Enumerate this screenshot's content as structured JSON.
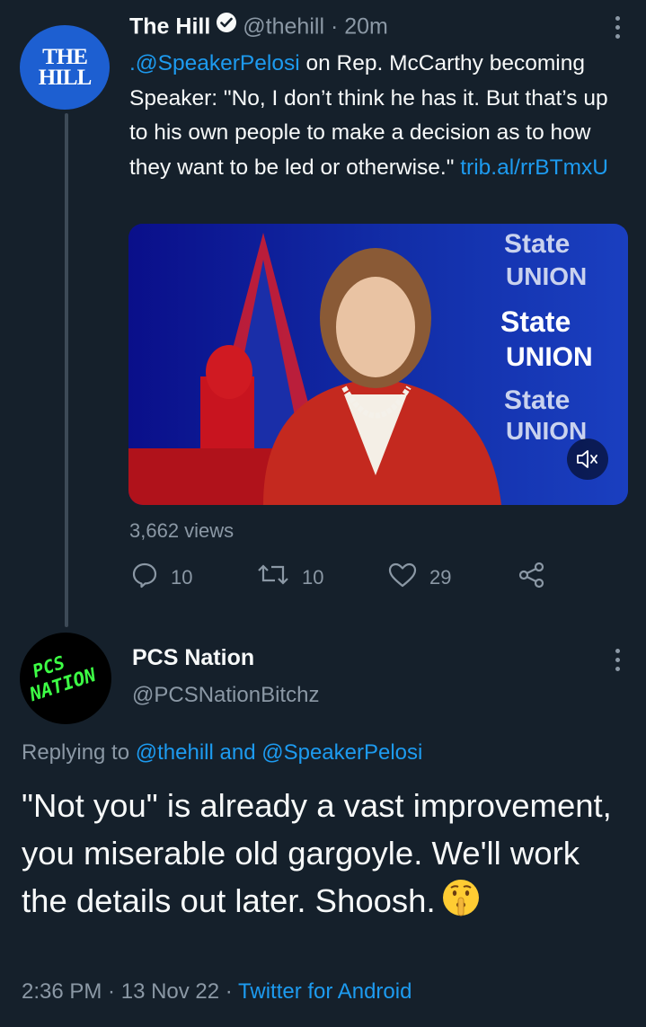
{
  "tweet": {
    "author_name": "The Hill",
    "handle": "@thehill",
    "separator": " · ",
    "time": "20m",
    "avatar_text": [
      "THE",
      "HILL"
    ],
    "mention": ".@SpeakerPelosi",
    "text": " on Rep. McCarthy becoming Speaker: \"No, I don’t think he has it. But that’s up to his own people to make a decision as to how they want to be led or otherwise.\" ",
    "link": "trib.al/rrBTmxU",
    "media": {
      "overlay_texts": [
        "State",
        "UNION",
        "State",
        "UNION",
        "State",
        "UNION"
      ]
    },
    "views": "3,662 views",
    "actions": {
      "reply_count": "10",
      "retweet_count": "10",
      "like_count": "29"
    }
  },
  "reply": {
    "author_name": "PCS Nation",
    "handle": "@PCSNationBitchz",
    "avatar_text": [
      "PCS",
      "NATION"
    ],
    "replying_prefix": "Replying to ",
    "replying_to_1": "@thehill",
    "replying_and": " and ",
    "replying_to_2": "@SpeakerPelosi",
    "text": "\"Not you\" is already a vast improvement, you miserable old gargoyle. We'll work the details out later. Shoosh.",
    "time": "2:36 PM",
    "date": "13 Nov 22",
    "source": "Twitter for Android",
    "separator": " · "
  },
  "colors": {
    "background": "#15202b",
    "link": "#1d9bf0",
    "muted": "#8b98a5",
    "hill_blue": "#1d5fd1",
    "pcs_green": "#3dff45"
  },
  "icons": [
    "verified-badge-icon",
    "more-options-icon",
    "reply-icon",
    "retweet-icon",
    "like-icon",
    "share-icon",
    "mute-icon",
    "shushing-face-emoji"
  ]
}
